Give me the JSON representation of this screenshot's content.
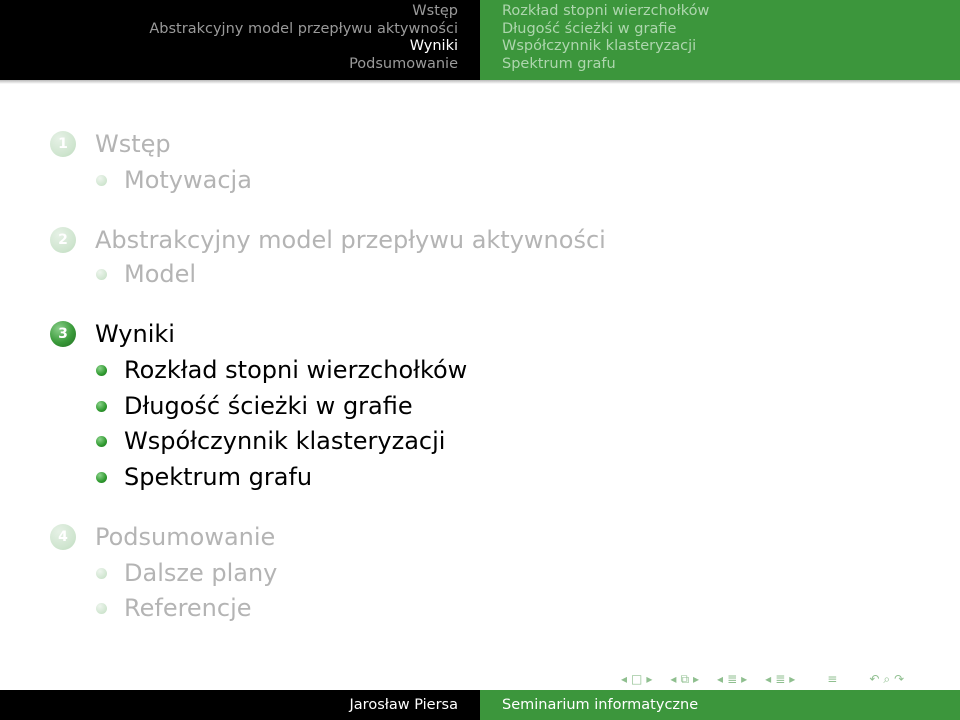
{
  "header": {
    "left_items": [
      {
        "label": "Wstęp",
        "active": false
      },
      {
        "label": "Abstrakcyjny model przepływu aktywności",
        "active": false
      },
      {
        "label": "Wyniki",
        "active": true
      },
      {
        "label": "Podsumowanie",
        "active": false
      }
    ],
    "right_items": [
      {
        "label": "Rozkład stopni wierzchołków"
      },
      {
        "label": "Długość ścieżki w grafie"
      },
      {
        "label": "Współczynnik klasteryzacji"
      },
      {
        "label": "Spektrum grafu"
      }
    ]
  },
  "outline": {
    "sections": [
      {
        "number": "1",
        "title": "Wstęp",
        "state": "faded",
        "subsections": [
          "Motywacja"
        ]
      },
      {
        "number": "2",
        "title": "Abstrakcyjny model przepływu aktywności",
        "state": "faded",
        "subsections": [
          "Model"
        ]
      },
      {
        "number": "3",
        "title": "Wyniki",
        "state": "current",
        "subsections": [
          "Rozkład stopni wierzchołków",
          "Długość ścieżki w grafie",
          "Współczynnik klasteryzacji",
          "Spektrum grafu"
        ]
      },
      {
        "number": "4",
        "title": "Podsumowanie",
        "state": "faded",
        "subsections": [
          "Dalsze plany",
          "Referencje"
        ]
      }
    ]
  },
  "nav_symbols": [
    "frame-prev-icon",
    "frame-box-icon",
    "frame-next-icon",
    "subsection-prev-icon",
    "subsection-box-icon",
    "subsection-next-icon",
    "section-prev-icon",
    "section-box-icon",
    "section-next-icon",
    "slide-prev-icon",
    "slide-box-icon",
    "slide-next-icon",
    "outline-icon",
    "search-back-icon",
    "search-icon",
    "search-forward-icon"
  ],
  "footer": {
    "author": "Jarosław Piersa",
    "title": "Seminarium informatyczne"
  },
  "colors": {
    "header_left_bg": "#000000",
    "header_right_bg": "#3c963c",
    "accent_green": "#3a9a3a",
    "faded_text": "#b4b4b4"
  }
}
